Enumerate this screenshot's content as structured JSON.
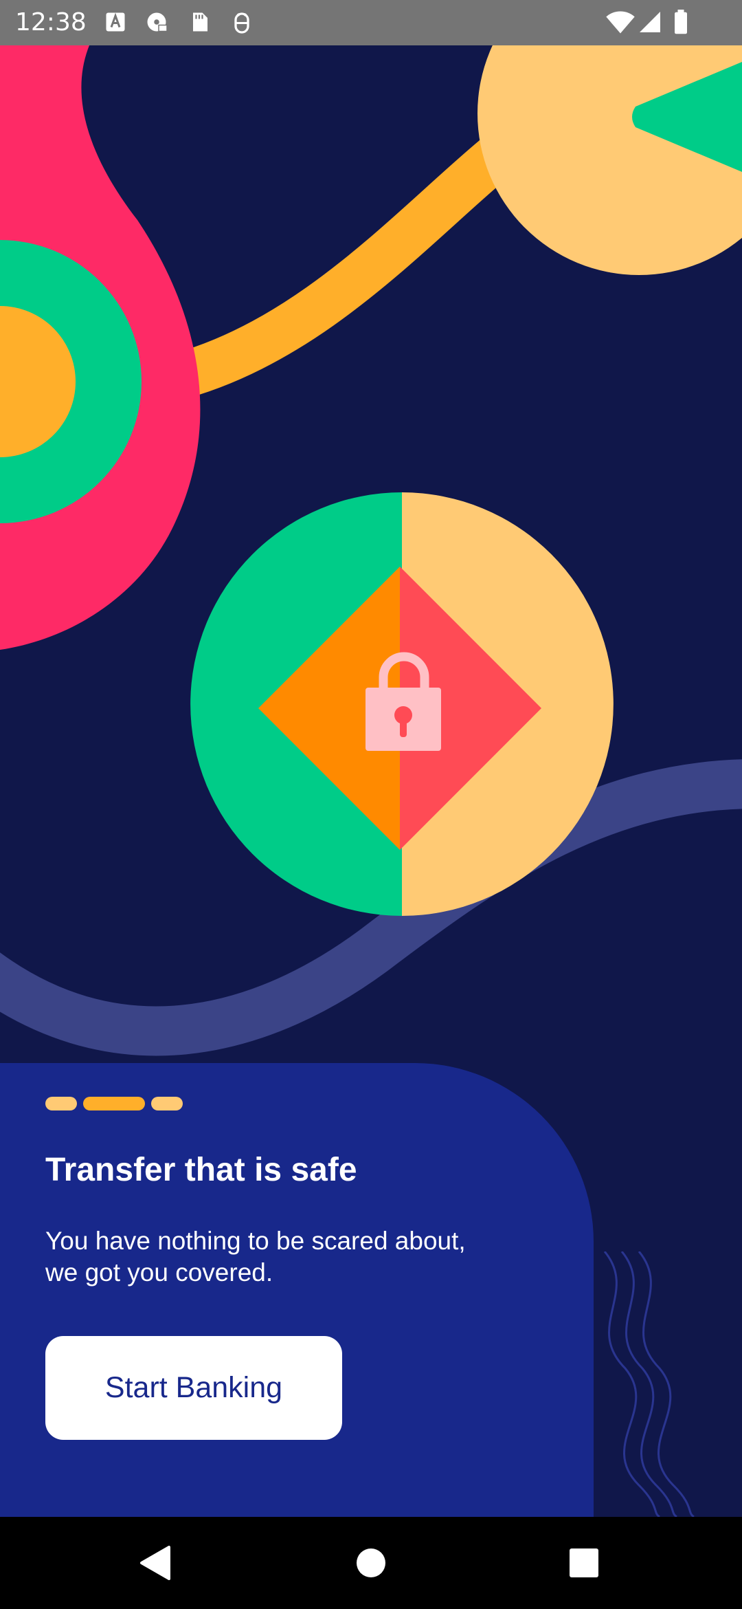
{
  "status_bar": {
    "time": "12:38",
    "left_icons": [
      "text-a-icon",
      "disc-icon",
      "sd-card-icon",
      "android-debug-icon"
    ],
    "right_icons": [
      "wifi-icon",
      "signal-icon",
      "battery-icon"
    ]
  },
  "onboarding": {
    "page_count": 3,
    "active_page": 2,
    "title": "Transfer that is safe",
    "subtitle": "You have nothing to be scared about, we got you covered.",
    "cta_label": "Start Banking"
  },
  "nav_bar": {
    "icons": [
      "back-icon",
      "home-icon",
      "recents-icon"
    ]
  },
  "colors": {
    "background": "#10174a",
    "card": "#18288b",
    "pink": "#fe2a66",
    "green": "#00cc88",
    "orange": "#ffaf2a",
    "peach": "#ffca74",
    "deep_orange": "#ff8a00",
    "coral": "#ff4b55",
    "lock": "#ffc0c5",
    "wave_path": "#3b4487"
  }
}
